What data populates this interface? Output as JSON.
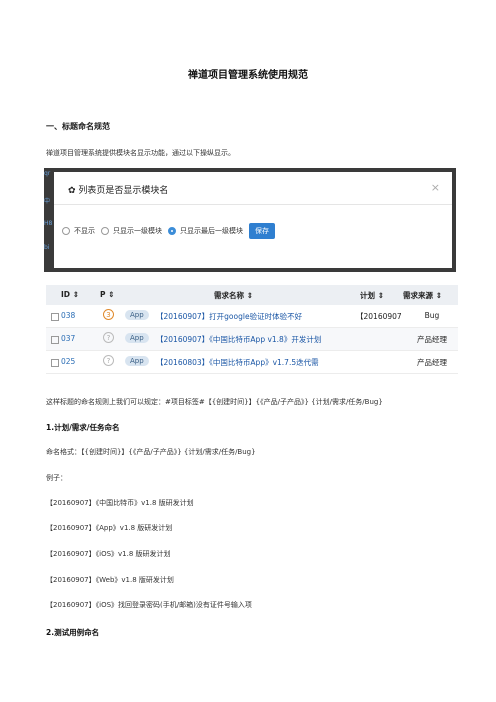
{
  "doc": {
    "title": "禅道项目管理系统使用规范",
    "section1": "一、标题命名规范",
    "intro": "禅道项目管理系统提供模块名显示功能，通过以下操纵显示。",
    "rule": "这样标题的命名规则上我们可以规定：#项目标签#【{创建时间}】{《产品/子产品》} {计划/需求/任务/Bug}",
    "sub1": "1.计划/需求/任务命名",
    "format": "命名格式：【{创建时间}】{《产品/子产品》} {计划/需求/任务/Bug}",
    "example_label": "例子：",
    "examples": [
      "【20160907】《中国比特币》v1.8 版研发计划",
      "【20160907】《App》v1.8 版研发计划",
      "【20160907】《iOS》v1.8 版研发计划",
      "【20160907】《Web》v1.8 版研发计划",
      "【20160907】《iOS》找回登录密码(手机/邮箱)没有证件号输入项"
    ],
    "sub2": "2.测试用例命名"
  },
  "dialog": {
    "title": "列表页是否显示模块名",
    "close": "×",
    "options": [
      "不显示",
      "只显示一级模块",
      "只显示最后一级模块"
    ],
    "selected": "只显示最后一级模块",
    "save": "保存",
    "edge_letters": [
      "qr",
      "中",
      "H8",
      "bi"
    ]
  },
  "table": {
    "headers": {
      "id": "ID ⇕",
      "p": "P ⇕",
      "name": "需求名称 ⇕",
      "plan": "计划 ⇕",
      "source": "需求来源 ⇕"
    },
    "rows": [
      {
        "id": "038",
        "priority": "3",
        "tag": "App",
        "name": "【20160907】打开google验证时体验不好",
        "plan": "【20160907",
        "source": "Bug"
      },
      {
        "id": "037",
        "priority": "?",
        "tag": "App",
        "name": "【20160907】《中国比特币App v1.8》开发计划",
        "plan": "",
        "source": "产品经理"
      },
      {
        "id": "025",
        "priority": "?",
        "tag": "App",
        "name": "【20160803】《中国比特币App》v1.7.5迭代需",
        "plan": "",
        "source": "产品经理"
      }
    ]
  }
}
